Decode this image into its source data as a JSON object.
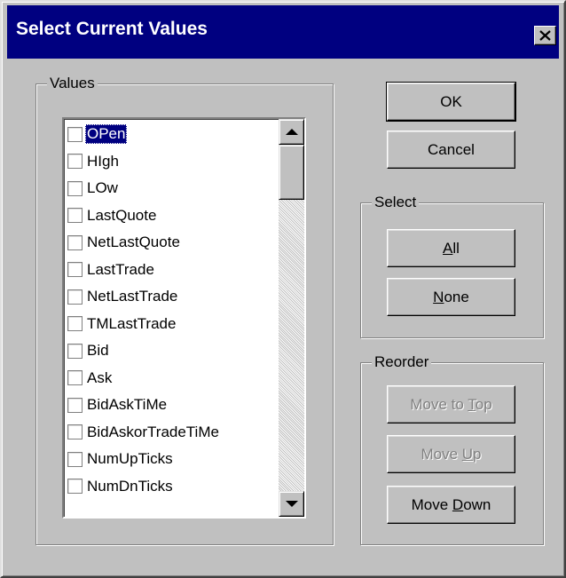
{
  "dialog": {
    "title": "Select Current Values",
    "close_icon": "close-x-icon"
  },
  "values_group": {
    "label": "Values",
    "selected_index": 0,
    "items": [
      {
        "label": "OPen",
        "checked": false
      },
      {
        "label": "HIgh",
        "checked": false
      },
      {
        "label": "LOw",
        "checked": false
      },
      {
        "label": "LastQuote",
        "checked": false
      },
      {
        "label": "NetLastQuote",
        "checked": false
      },
      {
        "label": "LastTrade",
        "checked": false
      },
      {
        "label": "NetLastTrade",
        "checked": false
      },
      {
        "label": "TMLastTrade",
        "checked": false
      },
      {
        "label": "Bid",
        "checked": false
      },
      {
        "label": "Ask",
        "checked": false
      },
      {
        "label": "BidAskTiMe",
        "checked": false
      },
      {
        "label": "BidAskorTradeTiMe",
        "checked": false
      },
      {
        "label": "NumUpTicks",
        "checked": false
      },
      {
        "label": "NumDnTicks",
        "checked": false
      }
    ],
    "scroll_position": 0
  },
  "buttons": {
    "ok": "OK",
    "cancel": "Cancel"
  },
  "select_group": {
    "label": "Select",
    "all": {
      "before": "",
      "accel": "A",
      "after": "ll"
    },
    "none": {
      "before": "",
      "accel": "N",
      "after": "one"
    }
  },
  "reorder_group": {
    "label": "Reorder",
    "move_to_top": {
      "before": "Move to ",
      "accel": "T",
      "after": "op",
      "enabled": false
    },
    "move_up": {
      "before": "Move ",
      "accel": "U",
      "after": "p",
      "enabled": false
    },
    "move_down": {
      "before": "Move ",
      "accel": "D",
      "after": "own",
      "enabled": true
    }
  },
  "colors": {
    "face": "#c0c0c0",
    "titlebar": "#000080",
    "selection": "#000080",
    "disabled_text": "#808080"
  }
}
